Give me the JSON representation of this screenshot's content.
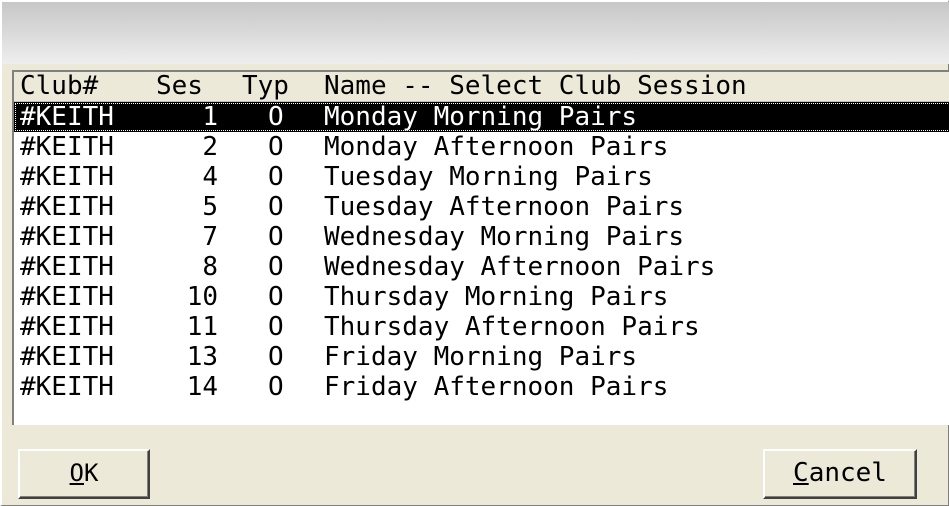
{
  "list": {
    "header": {
      "club": "Club#",
      "ses": "Ses",
      "typ": "Typ",
      "name": "Name -- Select Club Session"
    },
    "rows": [
      {
        "club": "#KEITH",
        "ses": "1",
        "typ": "O",
        "name": "Monday Morning Pairs",
        "selected": true
      },
      {
        "club": "#KEITH",
        "ses": "2",
        "typ": "O",
        "name": "Monday Afternoon Pairs"
      },
      {
        "club": "#KEITH",
        "ses": "4",
        "typ": "O",
        "name": "Tuesday Morning Pairs"
      },
      {
        "club": "#KEITH",
        "ses": "5",
        "typ": "O",
        "name": "Tuesday Afternoon Pairs"
      },
      {
        "club": "#KEITH",
        "ses": "7",
        "typ": "O",
        "name": "Wednesday Morning Pairs"
      },
      {
        "club": "#KEITH",
        "ses": "8",
        "typ": "O",
        "name": "Wednesday Afternoon Pairs"
      },
      {
        "club": "#KEITH",
        "ses": "10",
        "typ": "O",
        "name": "Thursday Morning Pairs"
      },
      {
        "club": "#KEITH",
        "ses": "11",
        "typ": "O",
        "name": "Thursday Afternoon Pairs"
      },
      {
        "club": "#KEITH",
        "ses": "13",
        "typ": "O",
        "name": "Friday Morning Pairs"
      },
      {
        "club": "#KEITH",
        "ses": "14",
        "typ": "O",
        "name": "Friday Afternoon Pairs"
      }
    ]
  },
  "buttons": {
    "ok": {
      "accel": "O",
      "rest": "K"
    },
    "cancel": {
      "accel": "C",
      "rest": "ancel"
    }
  },
  "colors": {
    "selection_bg": "#000000",
    "selection_fg": "#ffffff",
    "dialog_bg": "#ece9d8"
  }
}
